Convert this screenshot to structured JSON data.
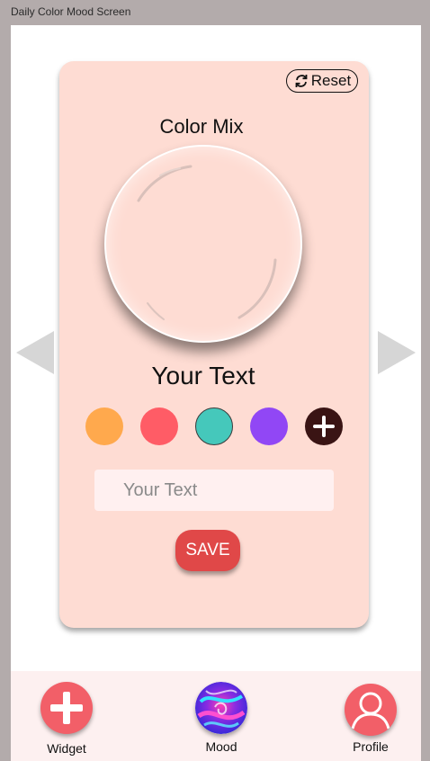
{
  "window": {
    "title": "Daily Color Mood Screen"
  },
  "card": {
    "reset_label": "Reset",
    "mix_title": "Color Mix",
    "display_text": "Your Text",
    "input_placeholder": "Your Text",
    "input_value": "",
    "save_label": "SAVE"
  },
  "swatches": [
    {
      "name": "orange",
      "color": "#ffa94d"
    },
    {
      "name": "red",
      "color": "#ff5c66"
    },
    {
      "name": "teal",
      "color": "#45c8bb"
    },
    {
      "name": "purple",
      "color": "#9147f5"
    }
  ],
  "colors": {
    "card_bg": "#fedcd3",
    "save_button": "#e04848",
    "tab_accent": "#f25f68",
    "add_swatch": "#3a1414"
  },
  "tabs": [
    {
      "label": "Widget",
      "icon": "plus-icon"
    },
    {
      "label": "Mood",
      "icon": "mood-swirl-icon"
    },
    {
      "label": "Profile",
      "icon": "profile-icon"
    }
  ]
}
